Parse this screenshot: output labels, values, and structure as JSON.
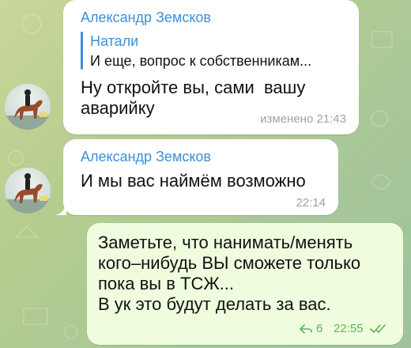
{
  "messages": [
    {
      "sender": "Александр Земсков",
      "reply": {
        "name": "Натали",
        "text": "И еще, вопрос к собственникам..."
      },
      "lines": [
        "Ну откройте вы, сами  вашу",
        "аварийку"
      ],
      "meta": "изменено 21:43"
    },
    {
      "sender": "Александр Земсков",
      "lines": [
        "И мы вас наймём возможно"
      ],
      "meta": "22:14"
    },
    {
      "lines": [
        "Заметьте, что нанимать/менять",
        "кого–нибудь ВЫ сможете только",
        "пока вы в ТСЖ...",
        "В ук это будут делать за вас."
      ],
      "reply_count": "6",
      "meta": "22:55"
    }
  ],
  "colors": {
    "accent": "#3f8fd6",
    "outgoing_bubble": "#effdde",
    "incoming_bubble": "#ffffff",
    "check": "#5fb35a"
  },
  "icons": {
    "avatar": "horse-rider-avatar",
    "reply_arrow": "reply-arrow-icon",
    "read_status": "double-check-icon"
  }
}
